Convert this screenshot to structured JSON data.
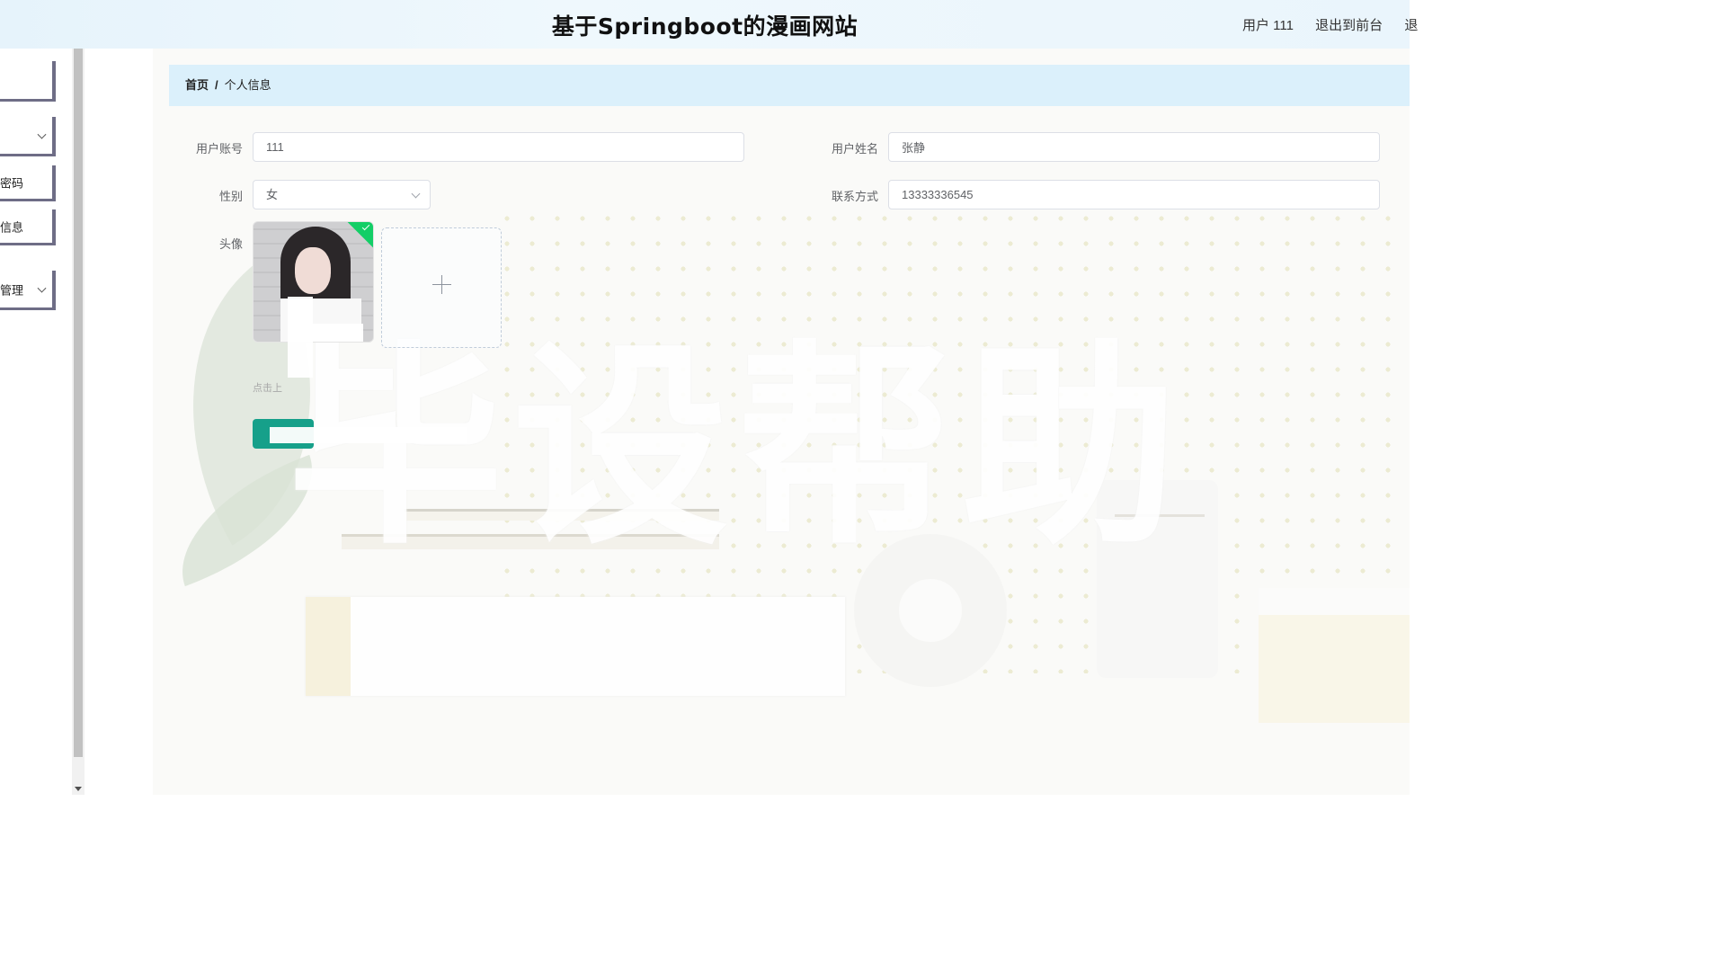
{
  "header": {
    "title": "基于Springboot的漫画网站",
    "user_label": "用户 111",
    "exit_label": "退出到前台",
    "logout_partial": "退"
  },
  "sidebar": {
    "items": [
      {
        "label": ""
      },
      {
        "label": ""
      },
      {
        "label": "密码"
      },
      {
        "label": "信息"
      },
      {
        "label": "管理"
      }
    ]
  },
  "breadcrumb": {
    "home": "首页",
    "separator": "/",
    "current": "个人信息"
  },
  "form": {
    "account_label": "用户账号",
    "account_value": "111",
    "name_label": "用户姓名",
    "name_value": "张静",
    "gender_label": "性别",
    "gender_value": "女",
    "phone_label": "联系方式",
    "phone_value": "13333336545",
    "avatar_label": "头像",
    "upload_tip": "点击上",
    "submit_label": ""
  },
  "background": {
    "watermark_text": "毕设帮助"
  },
  "colors": {
    "header_bg": "#e6f3fb",
    "breadcrumb_bg": "#dbf0fb",
    "accent": "#16a08a",
    "sidebar_border": "#6e6d86"
  }
}
